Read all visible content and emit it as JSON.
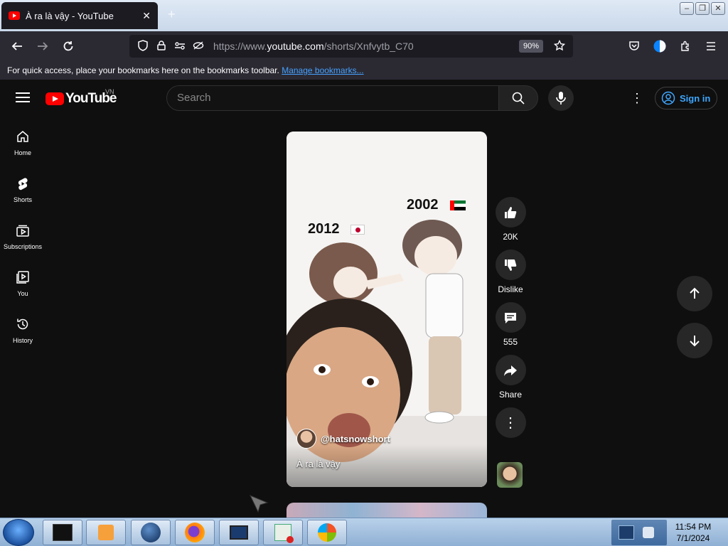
{
  "browser": {
    "tab_title": "À ra là vậy - YouTube",
    "url_prefix": "https://www.",
    "url_host": "youtube.com",
    "url_path": "/shorts/Xnfvytb_C70",
    "zoom": "90%",
    "bookmarks_text": "For quick access, place your bookmarks here on the bookmarks toolbar.",
    "bookmarks_link": "Manage bookmarks..."
  },
  "youtube": {
    "logo_word": "YouTube",
    "country_code": "VN",
    "search_placeholder": "Search",
    "signin_label": "Sign in",
    "sidebar": [
      {
        "label": "Home"
      },
      {
        "label": "Shorts"
      },
      {
        "label": "Subscriptions"
      },
      {
        "label": "You"
      },
      {
        "label": "History"
      }
    ],
    "short": {
      "year_left": "2012",
      "year_right": "2002",
      "channel": "@hatsnowshort",
      "caption": "À ra là vậy",
      "likes": "20K",
      "dislike_label": "Dislike",
      "comments": "555",
      "share_label": "Share"
    }
  },
  "taskbar": {
    "time": "11:54 PM",
    "date": "7/1/2024"
  }
}
